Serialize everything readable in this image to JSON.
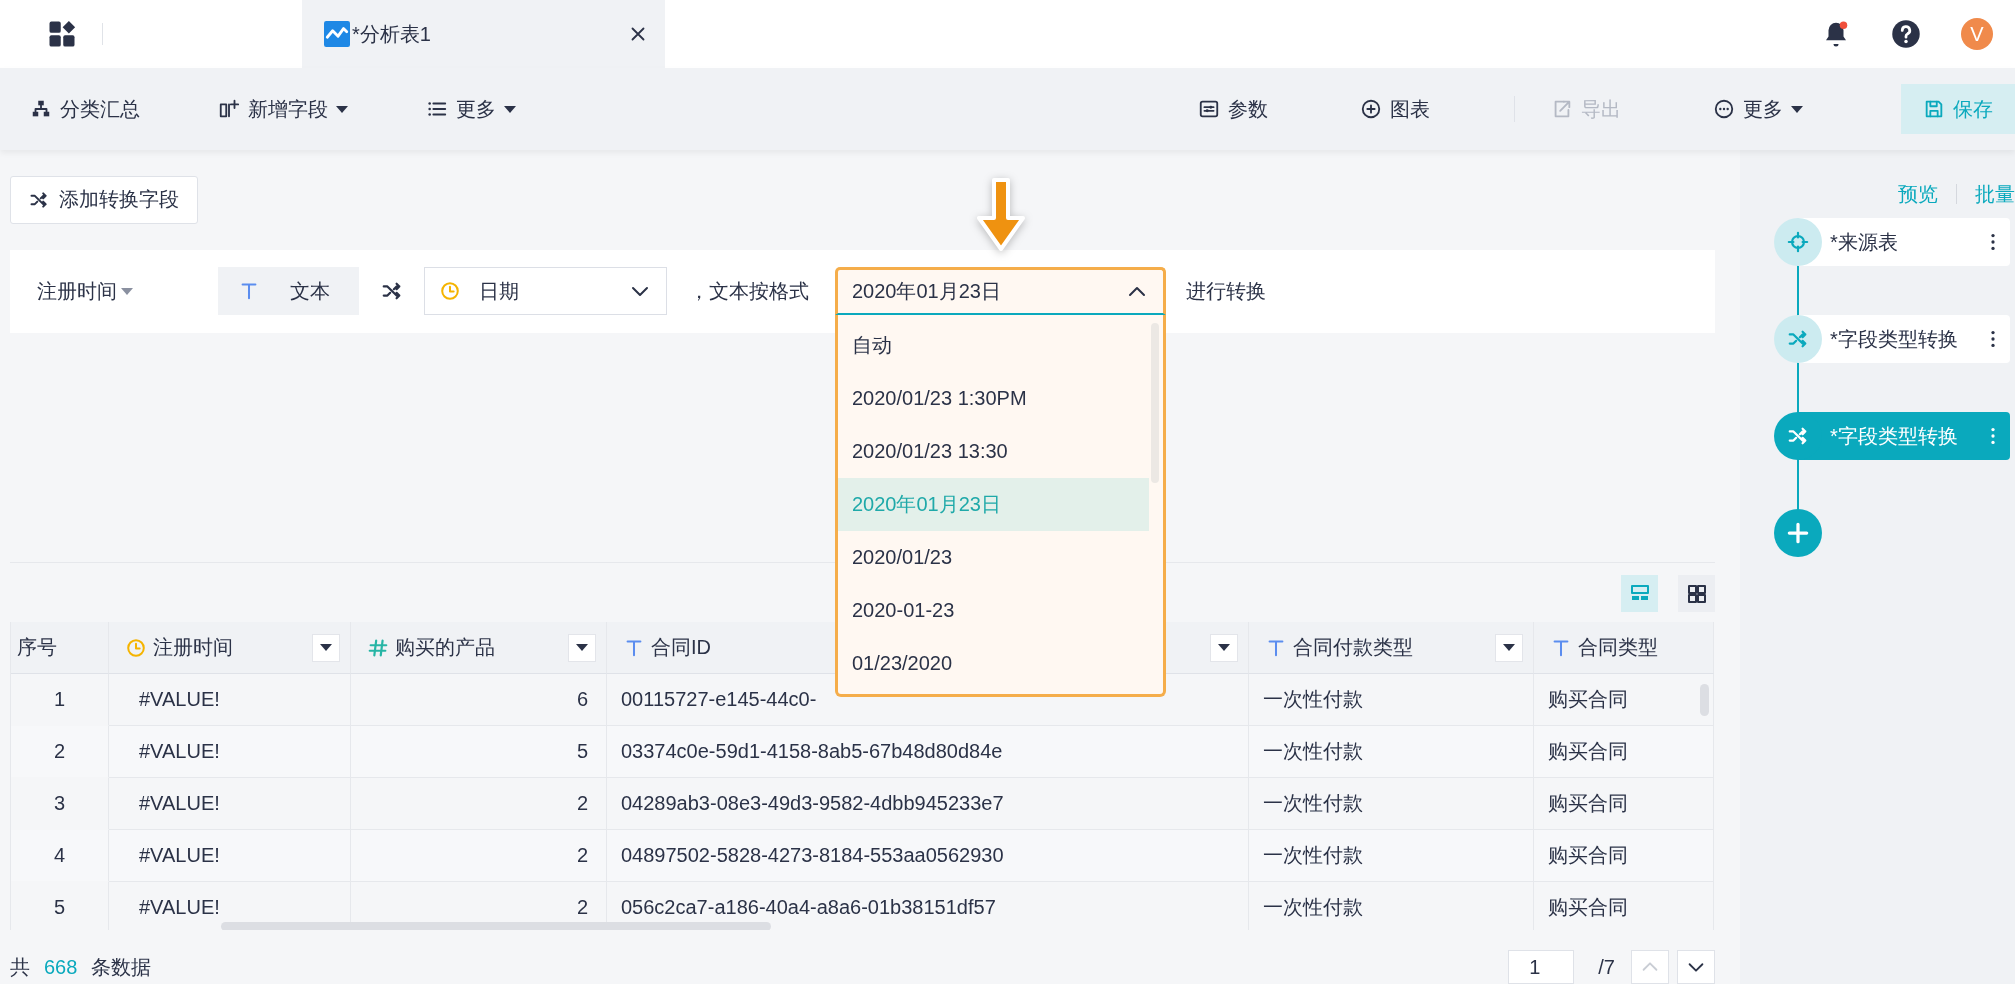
{
  "top_bar": {
    "tab": {
      "title": "*分析表1",
      "selected": true
    },
    "avatar": "V"
  },
  "toolbar": {
    "left": [
      {
        "label": "分类汇总",
        "caret": false
      },
      {
        "label": "新增字段",
        "caret": true
      },
      {
        "label": "更多",
        "caret": true
      }
    ],
    "right": [
      {
        "label": "参数",
        "caret": false,
        "disabled": false,
        "primary": false
      },
      {
        "label": "图表",
        "caret": false,
        "disabled": false,
        "primary": false
      },
      {
        "label": "导出",
        "caret": false,
        "disabled": true,
        "primary": false
      },
      {
        "label": "更多",
        "caret": true,
        "disabled": false,
        "primary": false
      },
      {
        "label": "保存",
        "caret": false,
        "disabled": false,
        "primary": true
      }
    ]
  },
  "add_button": "添加转换字段",
  "conversion": {
    "field": "注册时间",
    "source_type": "文本",
    "target_type": "日期",
    "connector": "，文本按格式",
    "action": "进行转换",
    "format": {
      "value": "2020年01月23日",
      "open": true,
      "options": [
        {
          "label": "自动",
          "selected": false
        },
        {
          "label": "2020/01/23 1:30PM",
          "selected": false
        },
        {
          "label": "2020/01/23 13:30",
          "selected": false
        },
        {
          "label": "2020年01月23日",
          "selected": true
        },
        {
          "label": "2020/01/23",
          "selected": false
        },
        {
          "label": "2020-01-23",
          "selected": false
        },
        {
          "label": "01/23/2020",
          "selected": false
        }
      ]
    }
  },
  "view_toggle": [
    {
      "selected": true
    },
    {
      "selected": false
    }
  ],
  "table": {
    "columns": [
      {
        "label": "序号",
        "kind": "index",
        "filter": false
      },
      {
        "label": "注册时间",
        "kind": "date",
        "filter": true
      },
      {
        "label": "购买的产品",
        "kind": "number",
        "filter": true
      },
      {
        "label": "合同ID",
        "kind": "text",
        "filter": true
      },
      {
        "label": "合同付款类型",
        "kind": "text",
        "filter": true
      },
      {
        "label": "合同类型",
        "kind": "text",
        "filter": false
      }
    ],
    "rows": [
      [
        "1",
        "#VALUE!",
        "6",
        "00115727-e145-44c0-",
        "一次性付款",
        "购买合同"
      ],
      [
        "2",
        "#VALUE!",
        "5",
        "03374c0e-59d1-4158-8ab5-67b48d80d84e",
        "一次性付款",
        "购买合同"
      ],
      [
        "3",
        "#VALUE!",
        "2",
        "04289ab3-08e3-49d3-9582-4dbb945233e7",
        "一次性付款",
        "购买合同"
      ],
      [
        "4",
        "#VALUE!",
        "2",
        "04897502-5828-4273-8184-553aa0562930",
        "一次性付款",
        "购买合同"
      ],
      [
        "5",
        "#VALUE!",
        "2",
        "056c2ca7-a186-40a4-a8a6-01b38151df57",
        "一次性付款",
        "购买合同"
      ]
    ]
  },
  "footer": {
    "prefix": "共",
    "count": "668",
    "suffix": "条数据"
  },
  "pagination": {
    "page": "1",
    "total": "/7",
    "prev_disabled": true
  },
  "flow_panel": {
    "links": [
      "预览",
      "批量"
    ],
    "nodes": [
      {
        "label": "*来源表",
        "kind": "source",
        "selected": false
      },
      {
        "label": "*字段类型转换",
        "kind": "transform",
        "selected": false
      },
      {
        "label": "*字段类型转换",
        "kind": "transform",
        "selected": true
      }
    ]
  }
}
